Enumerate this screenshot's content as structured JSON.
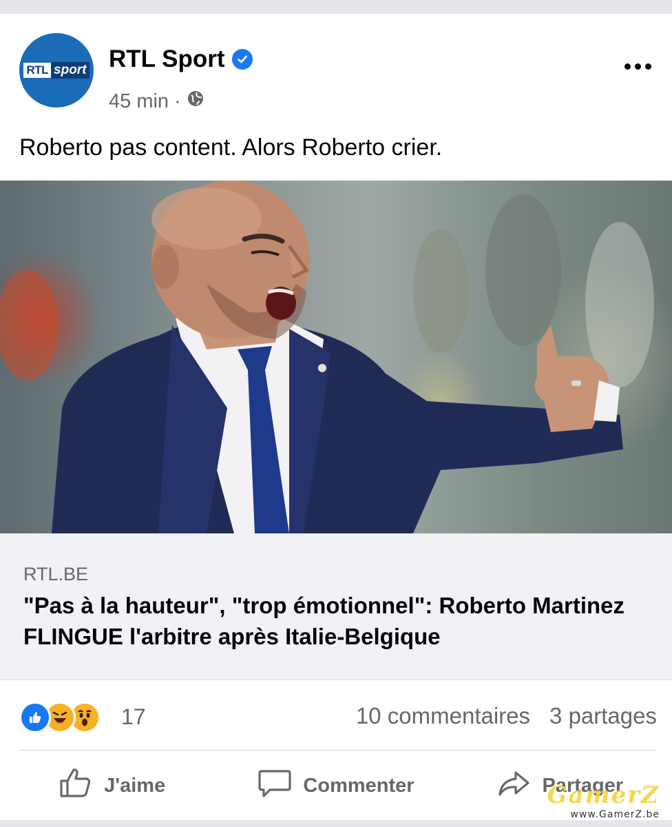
{
  "post": {
    "page_name": "RTL Sport",
    "avatar_text_1": "RTL",
    "avatar_text_2": "sport",
    "time": "45 min",
    "separator": "·",
    "text": "Roberto pas content. Alors Roberto crier."
  },
  "link_preview": {
    "domain": "RTL.BE",
    "headline": "\"Pas à la hauteur\", \"trop émotionnel\": Roberto Martinez FLINGUE l'arbitre après Italie-Belgique"
  },
  "stats": {
    "reaction_count": "17",
    "comments": "10 commentaires",
    "shares": "3 partages"
  },
  "actions": {
    "like": "J'aime",
    "comment": "Commenter",
    "share": "Partager"
  },
  "watermark": {
    "brand": "GamerZ",
    "url": "www.GamerZ.be"
  },
  "colors": {
    "verified": "#1877f2",
    "like_reaction": "#1877f2",
    "haha_reaction": "#f7b125",
    "secondary_text": "#65676b",
    "avatar_bg": "#1a6bb8"
  },
  "icons": [
    "verified-badge-icon",
    "globe-icon",
    "more-options-icon",
    "like-reaction-icon",
    "haha-reaction-icon",
    "wow-reaction-icon",
    "thumbs-up-icon",
    "comment-bubble-icon",
    "share-arrow-icon"
  ]
}
